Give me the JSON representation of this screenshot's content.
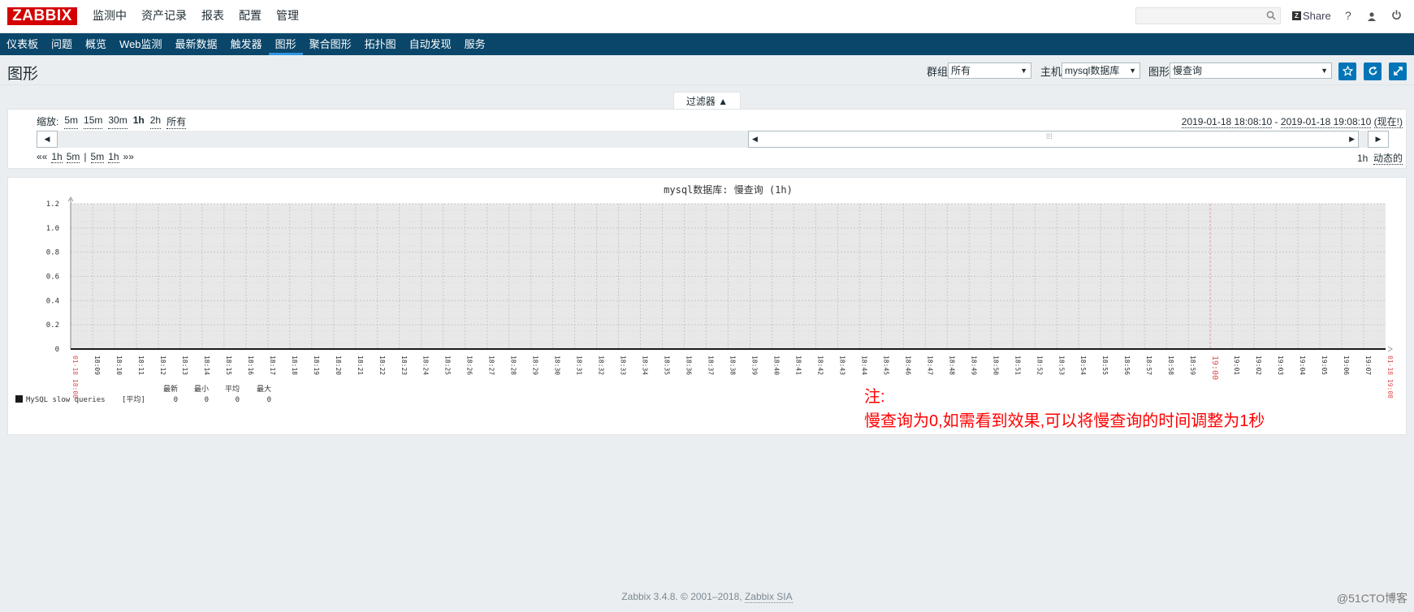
{
  "top": {
    "logo": "ZABBIX",
    "menu": [
      "监测中",
      "资产记录",
      "报表",
      "配置",
      "管理"
    ],
    "share": "Share",
    "help": "?",
    "colors": {
      "logo_bg": "#d40000",
      "subnav_bg": "#0a466a",
      "accent": "#0275b8"
    }
  },
  "subnav": [
    "仪表板",
    "问题",
    "概览",
    "Web监测",
    "最新数据",
    "触发器",
    "图形",
    "聚合图形",
    "拓扑图",
    "自动发现",
    "服务"
  ],
  "page": {
    "title": "图形",
    "group_label": "群组",
    "group_value": "所有",
    "host_label": "主机",
    "host_value": "mysql数据库",
    "graph_label": "图形",
    "graph_value": "慢查询"
  },
  "filter": {
    "tab_label": "过滤器 ▲",
    "zoom_label": "缩放:",
    "zoom_options": [
      "5m",
      "15m",
      "30m",
      "1h",
      "2h",
      "所有"
    ],
    "period_from": "2019-01-18 18:08:10",
    "period_sep": " - ",
    "period_to": "2019-01-18 19:08:10",
    "period_now": "(现在!)",
    "nav_back": "««",
    "nav_items": [
      "1h",
      "5m",
      "|",
      "5m",
      "1h"
    ],
    "nav_fwd": "»»",
    "period_len": "1h",
    "dynamic": "动态的"
  },
  "chart_data": {
    "type": "line",
    "title": "mysql数据库: 慢查询 (1h)",
    "ylim": [
      0,
      1.2
    ],
    "y_ticks": [
      "0",
      "0.2",
      "0.4",
      "0.6",
      "0.8",
      "1.0",
      "1.2"
    ],
    "x_start_label": "01-18 18:08",
    "x_end_label": "01-18 19:08",
    "x_ticks": [
      "18:09",
      "18:10",
      "18:11",
      "18:12",
      "18:13",
      "18:14",
      "18:15",
      "18:16",
      "18:17",
      "18:18",
      "18:19",
      "18:20",
      "18:21",
      "18:22",
      "18:23",
      "18:24",
      "18:25",
      "18:26",
      "18:27",
      "18:28",
      "18:29",
      "18:30",
      "18:31",
      "18:32",
      "18:33",
      "18:34",
      "18:35",
      "18:36",
      "18:37",
      "18:38",
      "18:39",
      "18:40",
      "18:41",
      "18:42",
      "18:43",
      "18:44",
      "18:45",
      "18:46",
      "18:47",
      "18:48",
      "18:49",
      "18:50",
      "18:51",
      "18:52",
      "18:53",
      "18:54",
      "18:55",
      "18:56",
      "18:57",
      "18:58",
      "18:59",
      "19:00",
      "19:01",
      "19:02",
      "19:03",
      "19:04",
      "19:05",
      "19:06",
      "19:07"
    ],
    "highlight_tick": "19:00",
    "grid": true,
    "series": [
      {
        "name": "MySQL slow queries",
        "func": "[平均]",
        "color": "#1a1a1a",
        "values": [
          0,
          0
        ]
      }
    ],
    "legend": {
      "headers": [
        "最新",
        "最小",
        "平均",
        "最大"
      ],
      "values": [
        "0",
        "0",
        "0",
        "0"
      ]
    }
  },
  "note": {
    "line1": "注:",
    "line2": "慢查询为0,如需看到效果,可以将慢查询的时间调整为1秒"
  },
  "footer": {
    "text": "Zabbix 3.4.8. © 2001–2018, ",
    "link": "Zabbix SIA"
  },
  "watermark": "@51CTO博客"
}
